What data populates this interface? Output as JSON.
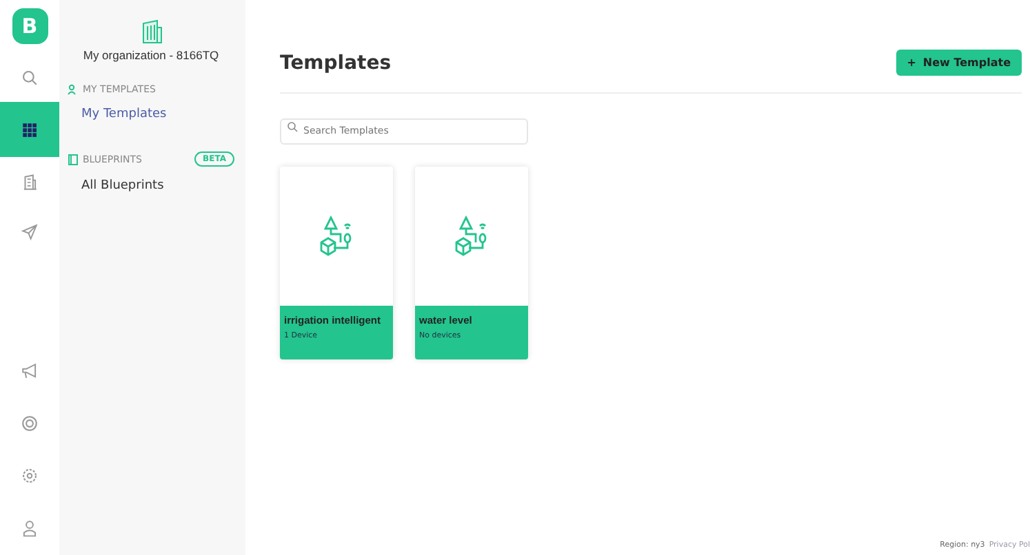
{
  "logo": "B",
  "rail": [
    {
      "selected": false
    },
    {
      "selected": true
    },
    {
      "selected": false
    },
    {
      "selected": false
    }
  ],
  "rail_bottom": [
    {
      "selected": false
    },
    {
      "selected": false
    },
    {
      "selected": false
    },
    {
      "selected": false
    }
  ],
  "sidebar": {
    "organization": "My organization - 8166TQ",
    "sections": [
      {
        "heading": "MY TEMPLATES",
        "items": [
          {
            "label": "My Templates",
            "selected": true
          }
        ]
      },
      {
        "heading": "BLUEPRINTS",
        "badge": "BETA",
        "items": [
          {
            "label": "All Blueprints",
            "selected": false
          }
        ]
      }
    ]
  },
  "main": {
    "title": "Templates",
    "new_button": {
      "icon": "+",
      "label": "New Template"
    },
    "search": {
      "placeholder": "Search Templates"
    },
    "templates": [
      {
        "name": "irrigation intelligent",
        "devices": "1 Device"
      },
      {
        "name": "water level",
        "devices": "No devices"
      }
    ]
  },
  "footer": {
    "region": "Region: ny3",
    "link": "Privacy Pol"
  }
}
